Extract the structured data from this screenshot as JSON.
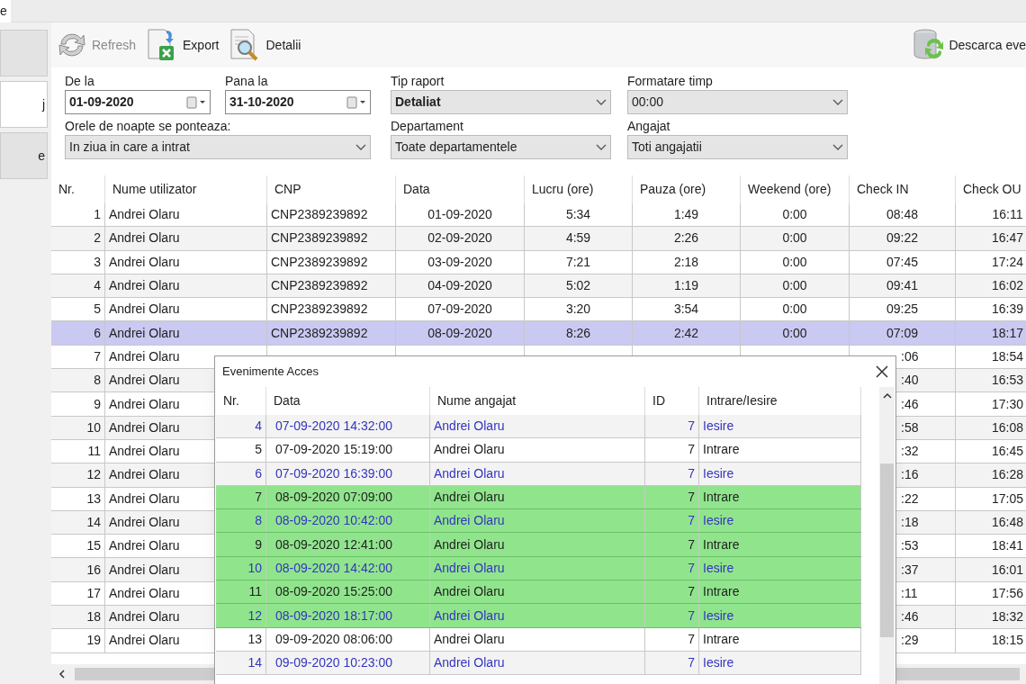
{
  "top_tab": {
    "label": "e"
  },
  "sidebar": {
    "items": [
      {
        "selected": false
      },
      {
        "label": "j",
        "selected": true
      },
      {
        "label": "e",
        "selected": false
      }
    ]
  },
  "toolbar": {
    "buttons": [
      {
        "kind": "refresh",
        "label": "Refresh",
        "disabled": true
      },
      {
        "kind": "export",
        "label": "Export",
        "disabled": false
      },
      {
        "kind": "details",
        "label": "Detalii",
        "disabled": false
      }
    ],
    "download_button": {
      "label": "Descarca eve"
    }
  },
  "filters": [
    [
      {
        "kind": "date",
        "label": "De la",
        "value": "01-09-2020",
        "bold": true
      },
      {
        "kind": "date",
        "label": "Pana la",
        "value": "31-10-2020",
        "bold": true
      },
      {
        "kind": "select",
        "label": "Tip raport",
        "value": "Detaliat",
        "bold": true
      },
      {
        "kind": "select",
        "label": "Formatare timp",
        "value": "00:00",
        "bold": false
      }
    ],
    [
      {
        "kind": "wide_select",
        "label": "Orele de noapte se ponteaza:",
        "value": "In ziua in care a intrat",
        "bold": false
      },
      {
        "kind": "select",
        "label": "Departament",
        "value": "Toate departamentele",
        "bold": false
      },
      {
        "kind": "select",
        "label": "Angajat",
        "value": "Toti angajatii",
        "bold": false
      }
    ]
  ],
  "table": {
    "columns": [
      "Nr.",
      "Nume utilizator",
      "CNP",
      "Data",
      "Lucru (ore)",
      "Pauza (ore)",
      "Weekend (ore)",
      "Check IN",
      "Check OU"
    ],
    "rows": [
      {
        "nr": "1",
        "user": "Andrei Olaru",
        "cnp": "CNP2389239892",
        "date": "01-09-2020",
        "work": "5:34",
        "pause": "1:49",
        "weekend": "0:00",
        "check_in": "08:48",
        "check_out": "16:11",
        "selected": false
      },
      {
        "nr": "2",
        "user": "Andrei Olaru",
        "cnp": "CNP2389239892",
        "date": "02-09-2020",
        "work": "4:59",
        "pause": "2:26",
        "weekend": "0:00",
        "check_in": "09:22",
        "check_out": "16:47",
        "selected": false
      },
      {
        "nr": "3",
        "user": "Andrei Olaru",
        "cnp": "CNP2389239892",
        "date": "03-09-2020",
        "work": "7:21",
        "pause": "2:18",
        "weekend": "0:00",
        "check_in": "07:45",
        "check_out": "17:24",
        "selected": false
      },
      {
        "nr": "4",
        "user": "Andrei Olaru",
        "cnp": "CNP2389239892",
        "date": "04-09-2020",
        "work": "5:02",
        "pause": "1:19",
        "weekend": "0:00",
        "check_in": "09:41",
        "check_out": "16:02",
        "selected": false
      },
      {
        "nr": "5",
        "user": "Andrei Olaru",
        "cnp": "CNP2389239892",
        "date": "07-09-2020",
        "work": "3:20",
        "pause": "3:54",
        "weekend": "0:00",
        "check_in": "09:25",
        "check_out": "16:39",
        "selected": false
      },
      {
        "nr": "6",
        "user": "Andrei Olaru",
        "cnp": "CNP2389239892",
        "date": "08-09-2020",
        "work": "8:26",
        "pause": "2:42",
        "weekend": "0:00",
        "check_in": "07:09",
        "check_out": "18:17",
        "selected": true
      },
      {
        "nr": "7",
        "user": "Andrei Olaru",
        "check_in": ":06",
        "check_out": "18:54",
        "selected": false
      },
      {
        "nr": "8",
        "user": "Andrei Olaru",
        "check_in": ":40",
        "check_out": "16:53",
        "selected": false
      },
      {
        "nr": "9",
        "user": "Andrei Olaru",
        "check_in": ":46",
        "check_out": "17:30",
        "selected": false
      },
      {
        "nr": "10",
        "user": "Andrei Olaru",
        "check_in": ":58",
        "check_out": "16:08",
        "selected": false
      },
      {
        "nr": "11",
        "user": "Andrei Olaru",
        "check_in": ":32",
        "check_out": "16:45",
        "selected": false
      },
      {
        "nr": "12",
        "user": "Andrei Olaru",
        "check_in": ":16",
        "check_out": "16:28",
        "selected": false
      },
      {
        "nr": "13",
        "user": "Andrei Olaru",
        "check_in": ":22",
        "check_out": "17:05",
        "selected": false
      },
      {
        "nr": "14",
        "user": "Andrei Olaru",
        "check_in": ":18",
        "check_out": "16:48",
        "selected": false
      },
      {
        "nr": "15",
        "user": "Andrei Olaru",
        "check_in": ":53",
        "check_out": "18:41",
        "selected": false
      },
      {
        "nr": "16",
        "user": "Andrei Olaru",
        "check_in": ":37",
        "check_out": "16:01",
        "selected": false
      },
      {
        "nr": "17",
        "user": "Andrei Olaru",
        "check_in": ":11",
        "check_out": "17:56",
        "selected": false
      },
      {
        "nr": "18",
        "user": "Andrei Olaru",
        "check_in": ":46",
        "check_out": "18:32",
        "selected": false
      },
      {
        "nr": "19",
        "user": "Andrei Olaru",
        "check_in": ":29",
        "check_out": "18:15",
        "selected": false
      }
    ]
  },
  "access_dialog": {
    "title": "Evenimente Acces",
    "columns": [
      "Nr.",
      "Data",
      "Nume angajat",
      "ID",
      "Intrare/Iesire"
    ],
    "rows": [
      {
        "nr": "4",
        "date": "07-09-2020 14:32:00",
        "employee": "Andrei Olaru",
        "id": "7",
        "direction": "Iesire",
        "kind": "exit",
        "highlighted": false
      },
      {
        "nr": "5",
        "date": "07-09-2020 15:19:00",
        "employee": "Andrei Olaru",
        "id": "7",
        "direction": "Intrare",
        "kind": "entry",
        "highlighted": false
      },
      {
        "nr": "6",
        "date": "07-09-2020 16:39:00",
        "employee": "Andrei Olaru",
        "id": "7",
        "direction": "Iesire",
        "kind": "exit",
        "highlighted": false
      },
      {
        "nr": "7",
        "date": "08-09-2020 07:09:00",
        "employee": "Andrei Olaru",
        "id": "7",
        "direction": "Intrare",
        "kind": "entry",
        "highlighted": true
      },
      {
        "nr": "8",
        "date": "08-09-2020 10:42:00",
        "employee": "Andrei Olaru",
        "id": "7",
        "direction": "Iesire",
        "kind": "exit",
        "highlighted": true
      },
      {
        "nr": "9",
        "date": "08-09-2020 12:41:00",
        "employee": "Andrei Olaru",
        "id": "7",
        "direction": "Intrare",
        "kind": "entry",
        "highlighted": true
      },
      {
        "nr": "10",
        "date": "08-09-2020 14:42:00",
        "employee": "Andrei Olaru",
        "id": "7",
        "direction": "Iesire",
        "kind": "exit",
        "highlighted": true
      },
      {
        "nr": "11",
        "date": "08-09-2020 15:25:00",
        "employee": "Andrei Olaru",
        "id": "7",
        "direction": "Intrare",
        "kind": "entry",
        "highlighted": true
      },
      {
        "nr": "12",
        "date": "08-09-2020 18:17:00",
        "employee": "Andrei Olaru",
        "id": "7",
        "direction": "Iesire",
        "kind": "exit",
        "highlighted": true
      },
      {
        "nr": "13",
        "date": "09-09-2020 08:06:00",
        "employee": "Andrei Olaru",
        "id": "7",
        "direction": "Intrare",
        "kind": "entry",
        "highlighted": false
      },
      {
        "nr": "14",
        "date": "09-09-2020 10:23:00",
        "employee": "Andrei Olaru",
        "id": "7",
        "direction": "Iesire",
        "kind": "exit",
        "highlighted": false
      }
    ]
  }
}
